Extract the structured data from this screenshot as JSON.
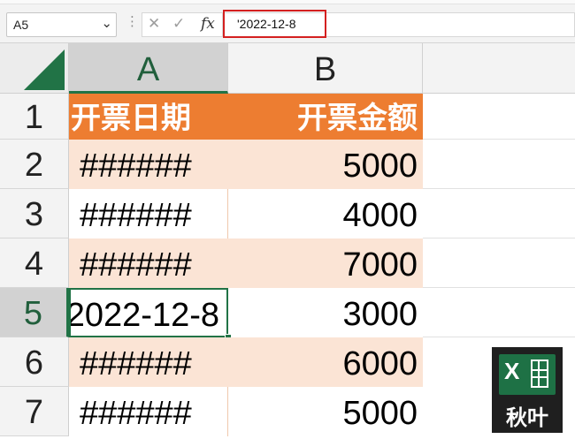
{
  "formula_bar": {
    "name_box": "A5",
    "dropdown_icon": "chevron-down-icon",
    "separator": "⋮",
    "cancel_icon": "✕",
    "enter_icon": "✓",
    "fx_label": "fx",
    "formula": "'2022-12-8",
    "highlight_color": "#d42020"
  },
  "columns": [
    "A",
    "B"
  ],
  "rows": [
    "1",
    "2",
    "3",
    "4",
    "5",
    "6",
    "7"
  ],
  "active_row": "5",
  "table": {
    "headers": [
      "开票日期",
      "开票金额"
    ],
    "a_values": [
      "######",
      "######",
      "######",
      "2022-12-8",
      "######",
      "######"
    ],
    "b_values": [
      "5000",
      "4000",
      "7000",
      "3000",
      "6000",
      "5000"
    ]
  },
  "colors": {
    "header_fill": "#ed7d31",
    "band_fill": "#fbe4d5",
    "excel_green": "#217346"
  },
  "logo": {
    "badge": "X",
    "caption": "秋叶"
  }
}
